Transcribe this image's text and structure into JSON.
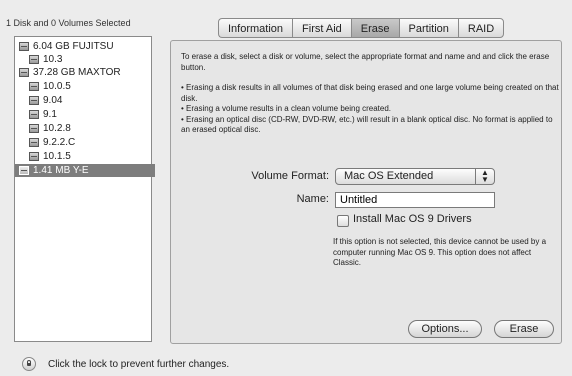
{
  "left_header": "1 Disk and 0 Volumes Selected",
  "disks": [
    {
      "label": "6.04 GB FUJITSU",
      "level": 0,
      "selected": false
    },
    {
      "label": "10.3",
      "level": 1,
      "selected": false
    },
    {
      "label": "37.28 GB MAXTOR",
      "level": 0,
      "selected": false
    },
    {
      "label": "10.0.5",
      "level": 1,
      "selected": false
    },
    {
      "label": "9.04",
      "level": 1,
      "selected": false
    },
    {
      "label": "9.1",
      "level": 1,
      "selected": false
    },
    {
      "label": "10.2.8",
      "level": 1,
      "selected": false
    },
    {
      "label": "9.2.2.C",
      "level": 1,
      "selected": false
    },
    {
      "label": "10.1.5",
      "level": 1,
      "selected": false
    },
    {
      "label": "1.41 MB Y-E",
      "level": 0,
      "selected": true
    }
  ],
  "tabs": [
    {
      "label": "Information",
      "active": false
    },
    {
      "label": "First Aid",
      "active": false
    },
    {
      "label": "Erase",
      "active": true
    },
    {
      "label": "Partition",
      "active": false
    },
    {
      "label": "RAID",
      "active": false
    }
  ],
  "erase": {
    "intro": "To erase a disk, select a disk or volume, select the appropriate format and name and and click the erase button.",
    "bullets": [
      "• Erasing a disk results in all volumes of that disk being erased and one large volume being created on that disk.",
      "• Erasing a volume results in a clean volume being created.",
      "• Erasing an optical disc (CD-RW, DVD-RW, etc.) will result in a blank optical disc. No format is applied to an erased optical disc."
    ],
    "volume_format_label": "Volume Format:",
    "volume_format_value": "Mac OS Extended",
    "name_label": "Name:",
    "name_value": "Untitled",
    "install_drivers_label": "Install Mac OS 9 Drivers",
    "note": "If this option is not selected, this device cannot be used by a computer running Mac OS 9.  This option does not affect Classic.",
    "options_button": "Options...",
    "erase_button": "Erase"
  },
  "footer": {
    "text": "Click the lock to prevent further changes."
  }
}
